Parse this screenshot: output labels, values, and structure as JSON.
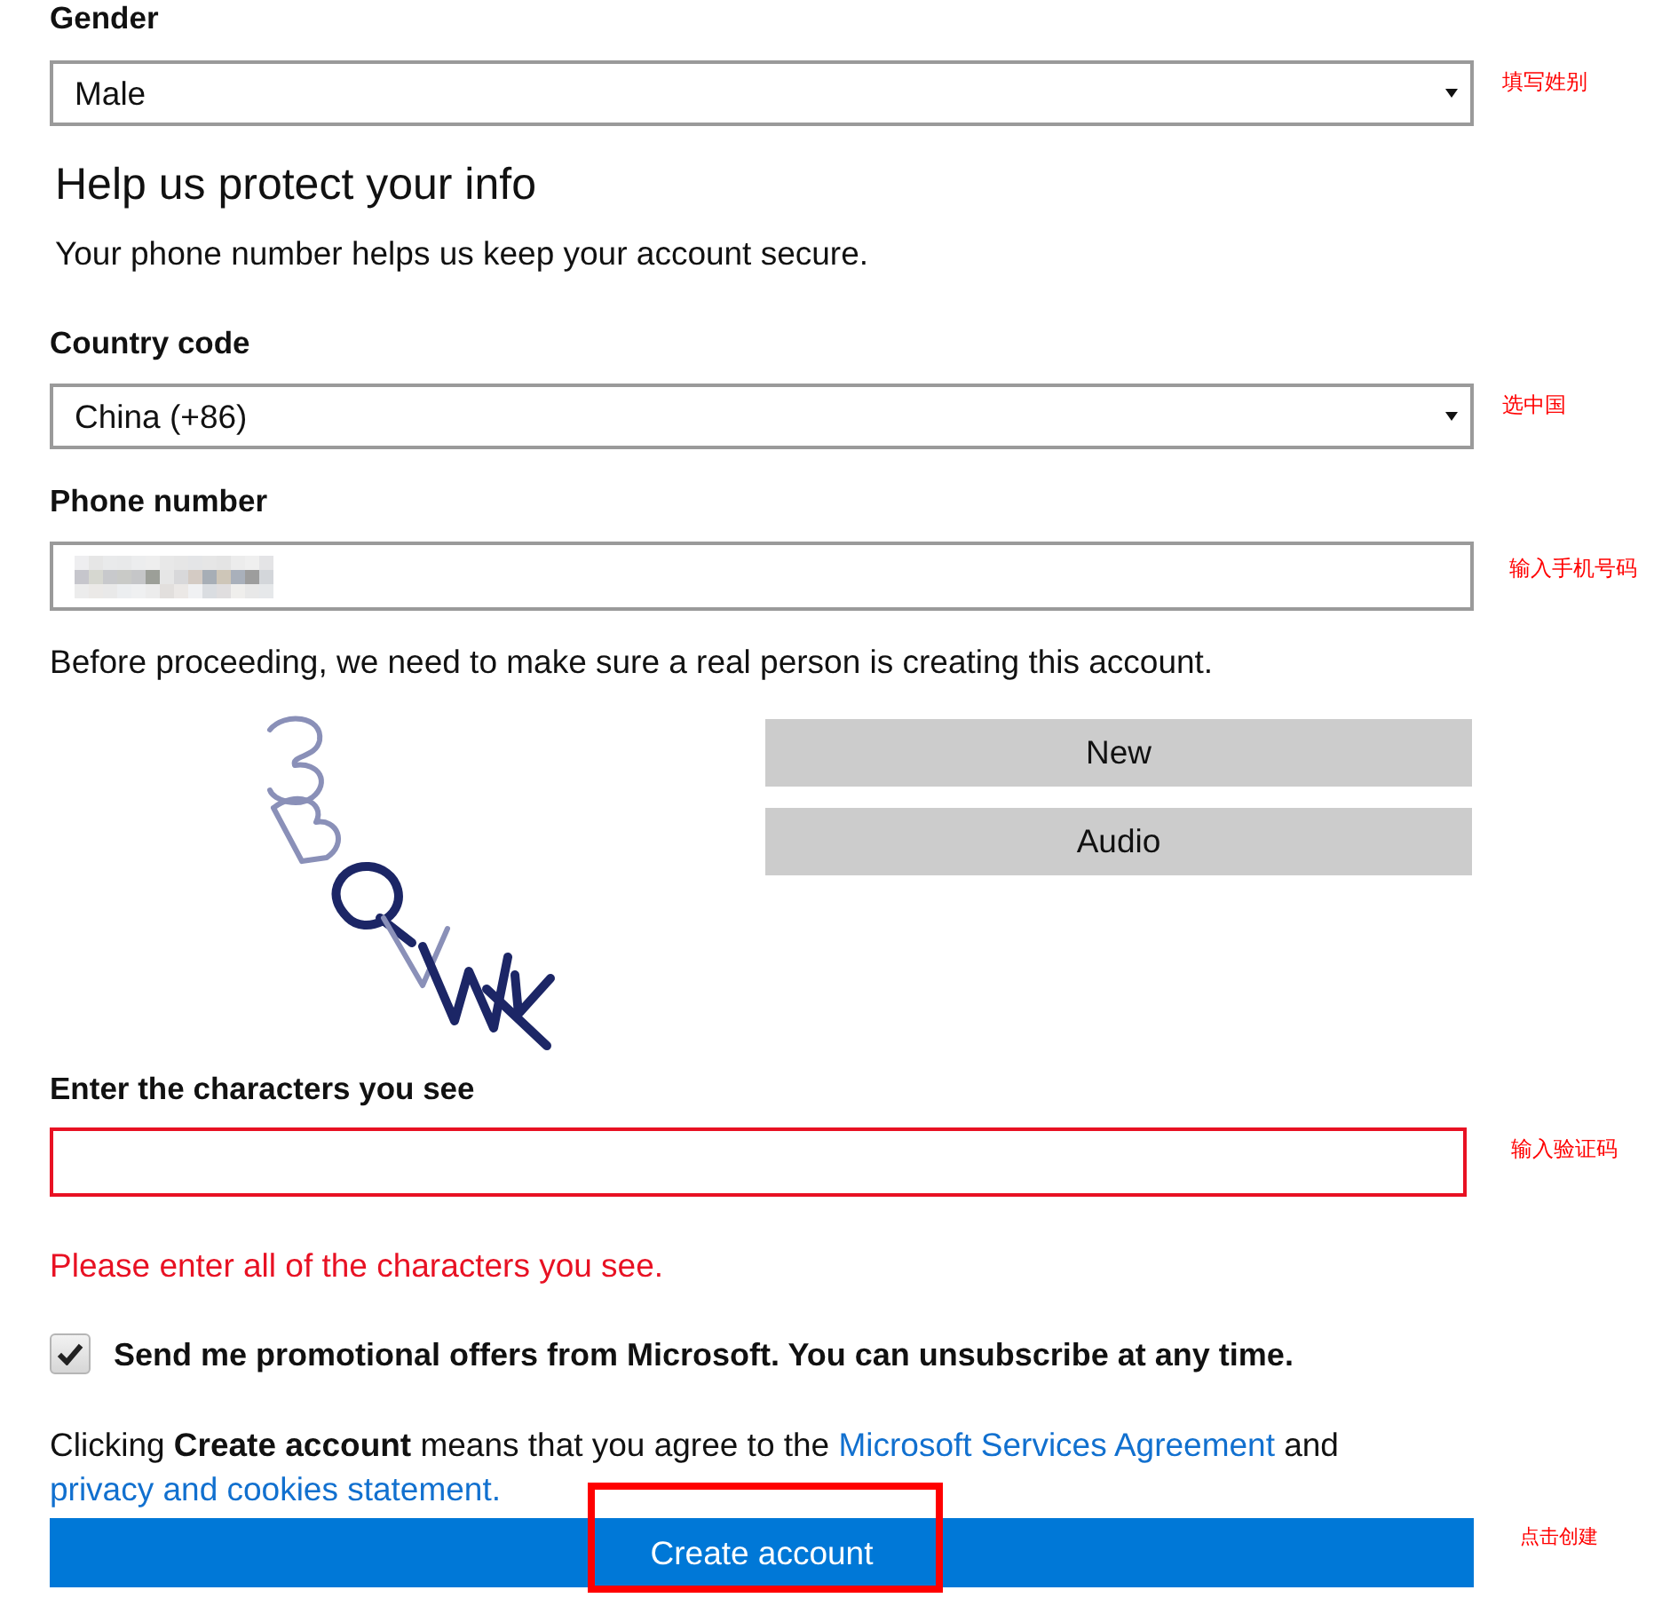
{
  "form": {
    "gender": {
      "label": "Gender",
      "value": "Male",
      "annotation": "填写姓别"
    },
    "section": {
      "title": "Help us protect your info",
      "description": "Your phone number helps us keep your account secure."
    },
    "country_code": {
      "label": "Country code",
      "value": "China (+86)",
      "annotation": "选中国"
    },
    "phone_number": {
      "label": "Phone number",
      "value_obscured": true,
      "annotation": "输入手机号码"
    },
    "captcha": {
      "intro": "Before proceeding, we need to make sure a real person is creating this account.",
      "buttons": [
        "New",
        "Audio"
      ],
      "label": "Enter the characters you see",
      "invalid": true,
      "annotation": "输入验证码",
      "error": "Please enter all of the characters you see."
    },
    "promo": {
      "label": "Send me promotional offers from Microsoft. You can unsubscribe at any time.",
      "checked": true
    },
    "agreement": [
      {
        "kind": "text",
        "text": "Clicking **Create account** means that you agree to the "
      },
      {
        "kind": "link",
        "text": "Microsoft Services Agreement"
      },
      {
        "kind": "text",
        "text": " and "
      },
      {
        "kind": "link",
        "text": "privacy and cookies statement."
      }
    ],
    "submit": {
      "label": "Create account",
      "highlighted": true,
      "annotation": "点击创建"
    }
  }
}
